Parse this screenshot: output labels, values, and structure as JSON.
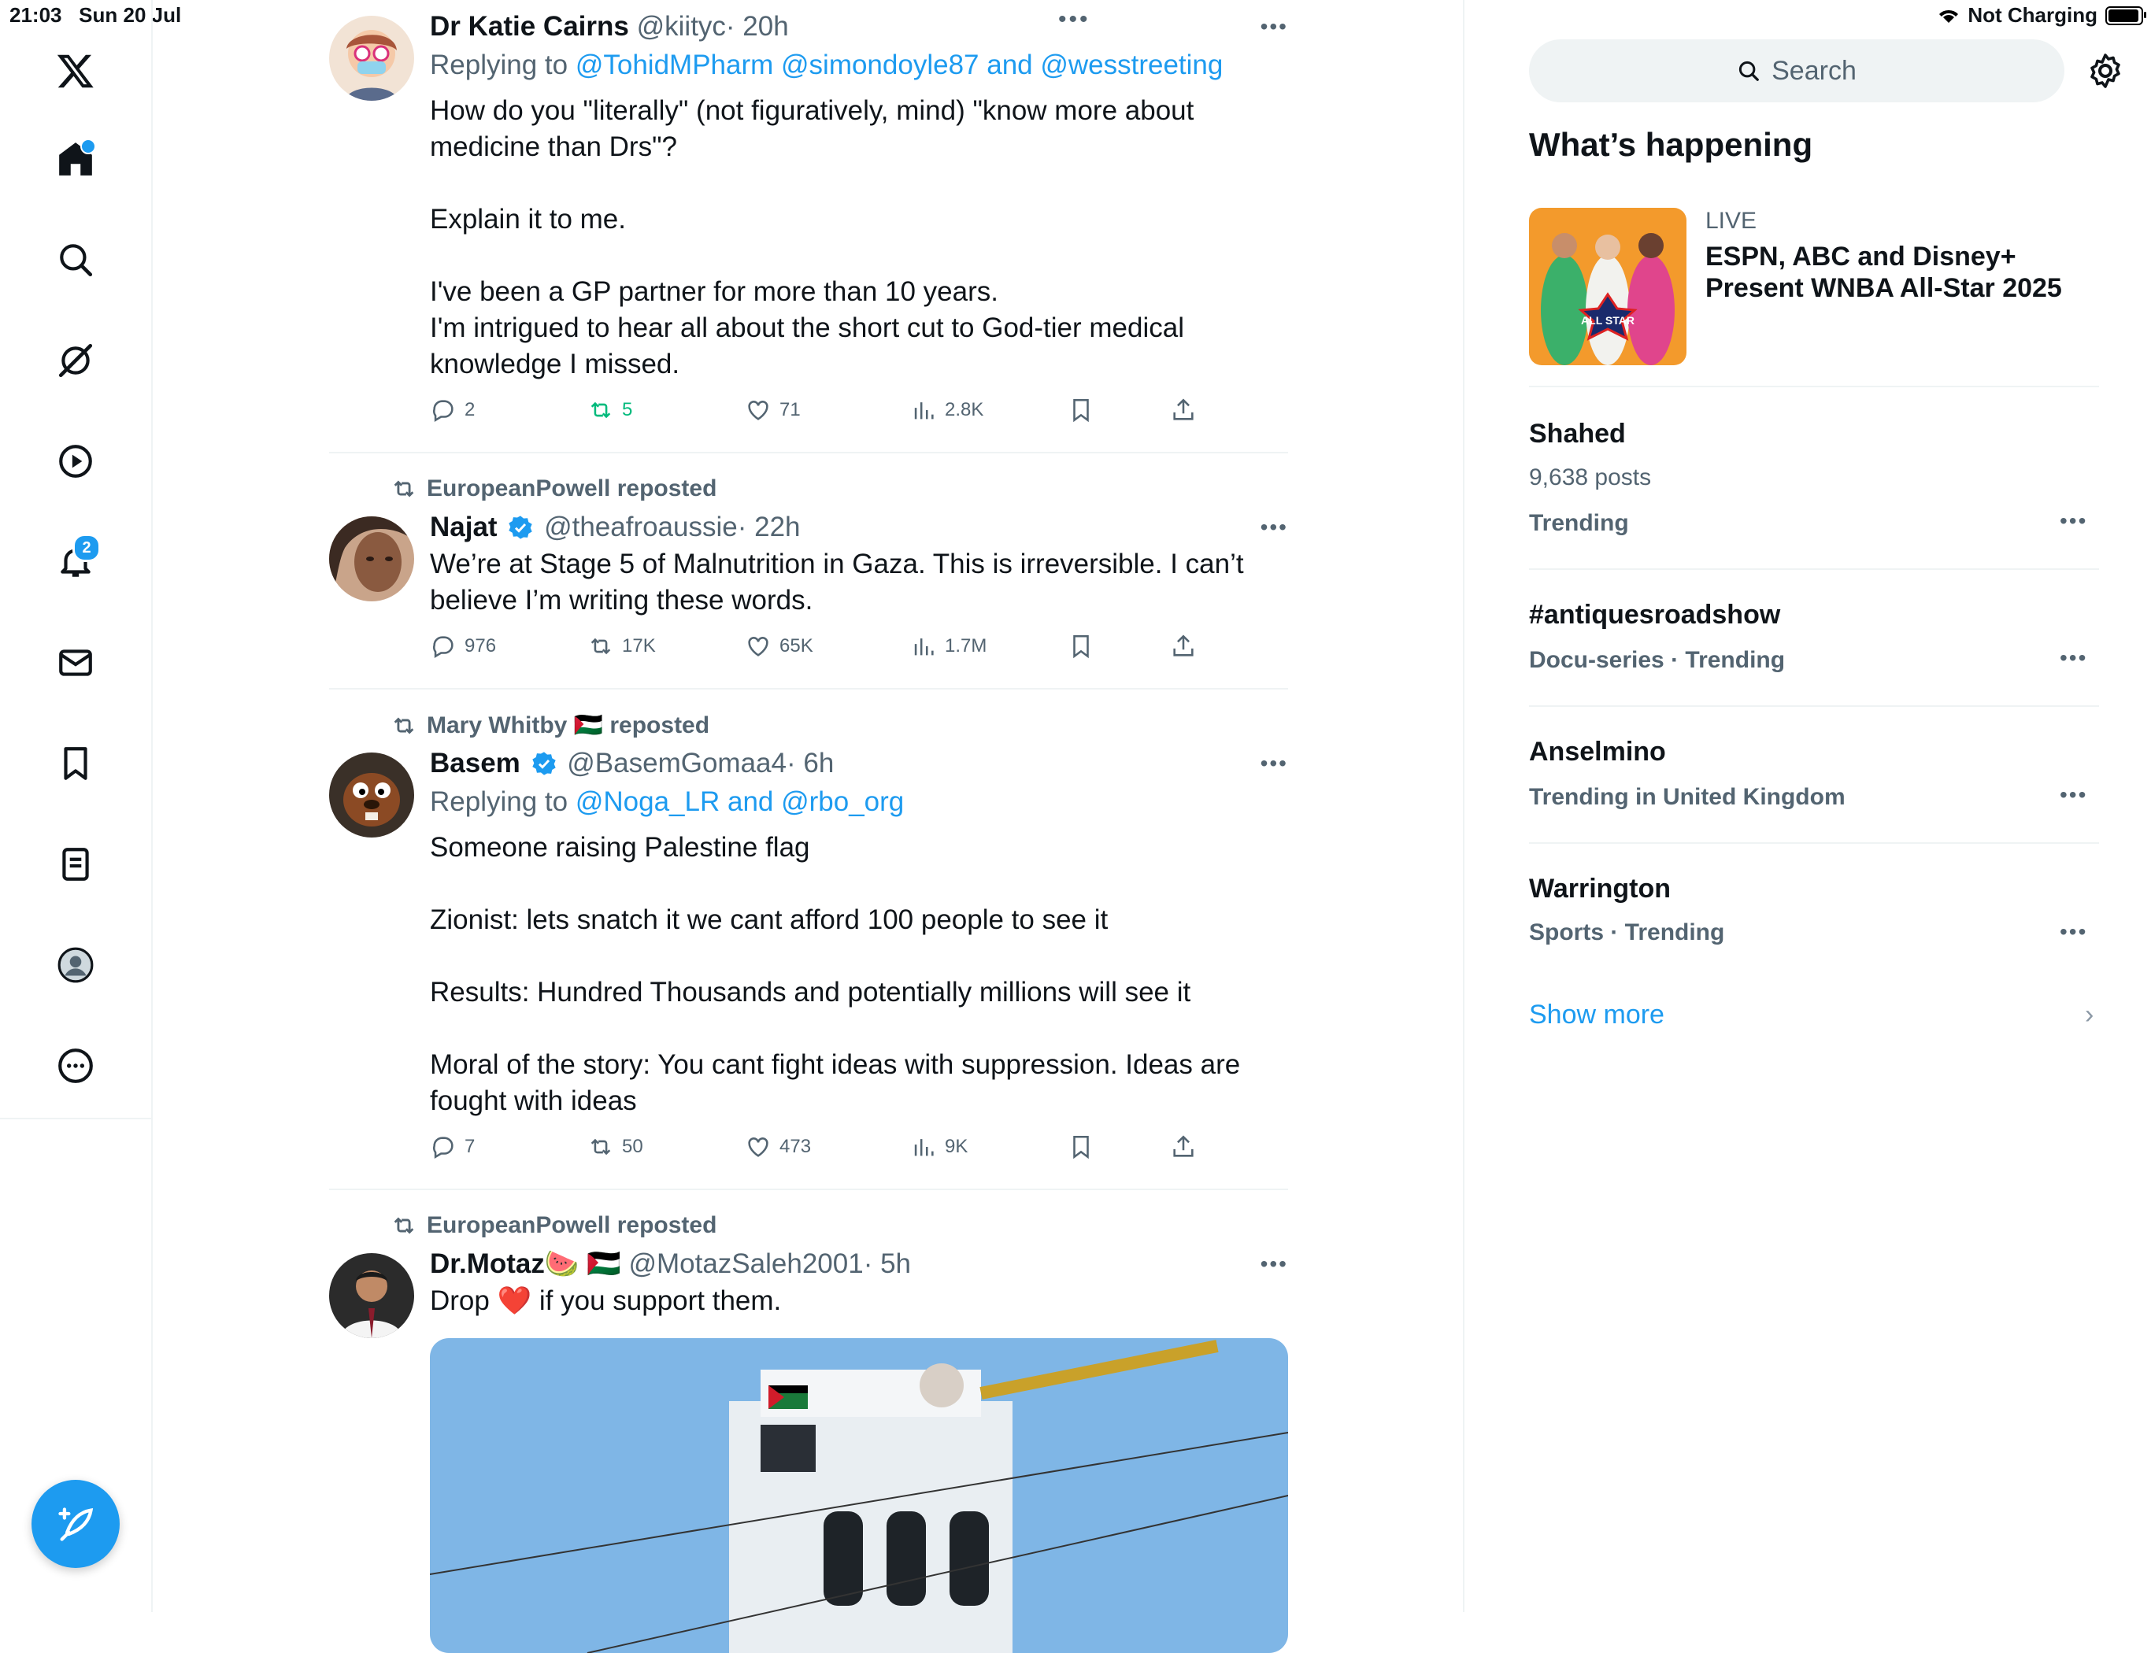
{
  "status_bar": {
    "time": "21:03",
    "date": "Sun 20 Jul",
    "charging": "Not Charging"
  },
  "nav": {
    "notifications_badge": "2",
    "items": [
      "x-logo",
      "home",
      "explore",
      "grok",
      "video",
      "notifications",
      "messages",
      "bookmarks",
      "lists",
      "profile",
      "more"
    ]
  },
  "feed": {
    "posts": [
      {
        "repost_by": "",
        "name": "Dr Katie Cairns",
        "handle": "@kiityc",
        "time": "· 20h",
        "reply_prefix": "Replying to",
        "reply_to": "@TohidMPharm @simondoyle87 and @wesstreeting",
        "text": "How do you \"literally\" (not figuratively, mind) \"know more about\nmedicine than Drs\"?\n\nExplain it to me.\n\nI've been a GP partner for more than 10 years.\nI'm intrigued to hear all about the short cut to God-tier medical\nknowledge I missed.",
        "replies": "2",
        "reposts": "5",
        "likes": "71",
        "views": "2.8K"
      },
      {
        "repost_by": "EuropeanPowell reposted",
        "name": "Najat",
        "handle": "@theafroaussie",
        "time": "· 22h",
        "text": "We’re at Stage 5 of Malnutrition in Gaza. This is irreversible. I can’t\nbelieve I’m writing these words.",
        "replies": "976",
        "reposts": "17K",
        "likes": "65K",
        "views": "1.7M"
      },
      {
        "repost_by": "Mary Whitby 🇵🇸 reposted",
        "name": "Basem",
        "handle": "@BasemGomaa4",
        "time": "· 6h",
        "reply_prefix": "Replying to",
        "reply_to": "@Noga_LR and @rbo_org",
        "text": "Someone raising Palestine flag\n\nZionist: lets snatch it we cant afford 100 people to see it\n\nResults: Hundred Thousands and potentially millions will see it\n\nMoral of the story: You cant fight ideas with suppression. Ideas are\nfought with ideas",
        "replies": "7",
        "reposts": "50",
        "likes": "473",
        "views": "9K"
      },
      {
        "repost_by": "EuropeanPowell reposted",
        "name": "Dr.Motaz🍉 🇵🇸",
        "handle": "@MotazSaleh2001",
        "time": "· 5h",
        "text": "Drop ❤️ if you support them."
      }
    ]
  },
  "sidebar": {
    "search_placeholder": "Search",
    "heading": "What’s happening",
    "live": {
      "label": "LIVE",
      "title": "ESPN, ABC and Disney+ Present WNBA All-Star 2025",
      "image_text": "ALL STAR"
    },
    "trends": [
      {
        "name": "Shahed",
        "sub": "9,638 posts",
        "meta": "Trending"
      },
      {
        "name": "#antiquesroadshow",
        "meta": "Docu-series · Trending"
      },
      {
        "name": "Anselmino",
        "meta": "Trending in United Kingdom"
      },
      {
        "name": "Warrington",
        "meta": "Sports · Trending"
      }
    ],
    "show_more": "Show more"
  },
  "colors": {
    "accent": "#1d9bf0",
    "repost_green": "#00ba7c",
    "muted": "#536471"
  }
}
